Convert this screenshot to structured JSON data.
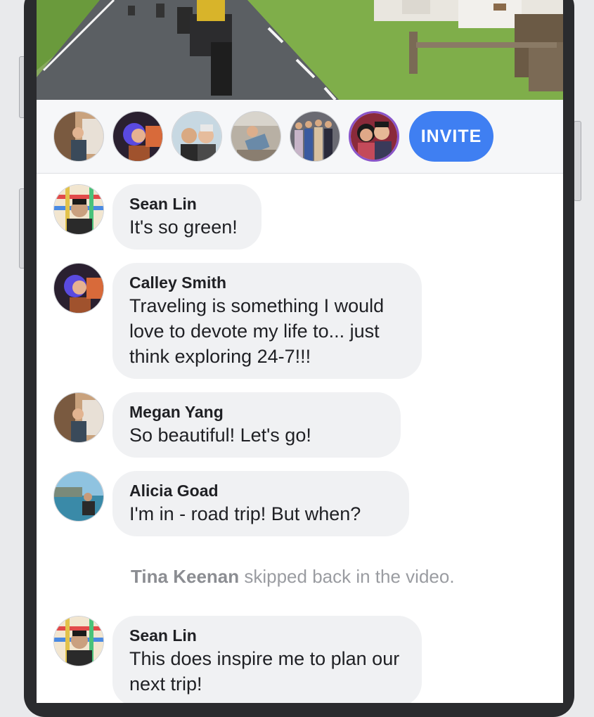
{
  "viewers": {
    "avatars": [
      {
        "name": "viewer-avatar-1"
      },
      {
        "name": "viewer-avatar-2"
      },
      {
        "name": "viewer-avatar-3"
      },
      {
        "name": "viewer-avatar-4"
      },
      {
        "name": "viewer-avatar-5"
      },
      {
        "name": "host-avatar"
      }
    ],
    "invite_label": "INVITE"
  },
  "comments": [
    {
      "name": "Sean Lin",
      "text": "It's so green!"
    },
    {
      "name": "Calley Smith",
      "text": "Traveling is something I would love to devote my life to... just think exploring 24-7!!!"
    },
    {
      "name": "Megan Yang",
      "text": "So beautiful! Let's go!"
    },
    {
      "name": "Alicia Goad",
      "text": "I'm in - road trip! But when?"
    },
    {
      "name": "Sean Lin",
      "text": "This does inspire me to plan our next trip!"
    }
  ],
  "system_message": {
    "actor": "Tina Keenan",
    "text": "skipped back in the video."
  },
  "colors": {
    "accent_blue": "#3f7ff2",
    "host_purple": "#8a55c9",
    "bubble_bg": "#f0f1f3"
  }
}
